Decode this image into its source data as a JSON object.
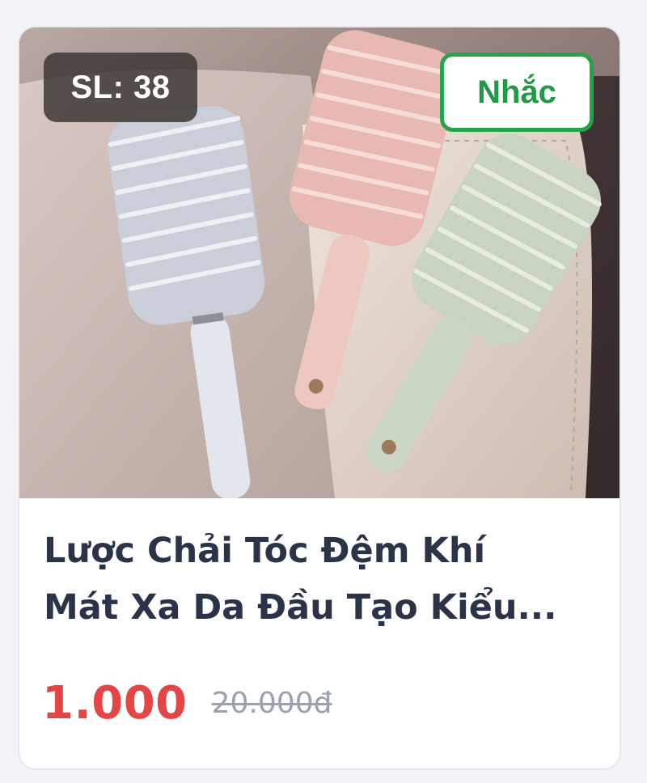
{
  "product": {
    "image_alt": "Ba chiếc lược chải tóc đệm khí màu trắng, hồng, xanh",
    "quantity_label": "SL: 38",
    "remind_label": "Nhắc",
    "title_line1": "Lược Chải Tóc Đệm Khí",
    "title_line2": "Mát Xa Da Đầu Tạo Kiểu...",
    "price": "1.000",
    "original_price": "20.000đ"
  },
  "colors": {
    "price": "#e64545",
    "remind_border": "#22a447",
    "title": "#2a3348",
    "old_price": "#9aa2b1"
  },
  "icons": [
    "hair-brush-photo"
  ]
}
